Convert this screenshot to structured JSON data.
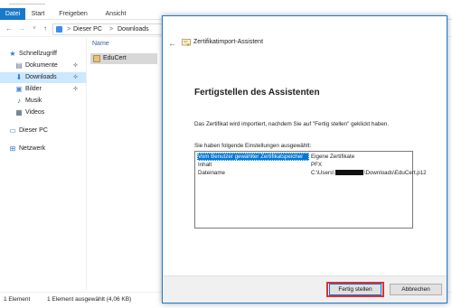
{
  "ribbon": {
    "tabs": [
      "Datei",
      "Start",
      "Freigeben",
      "Ansicht"
    ]
  },
  "addressbar": {
    "crumbs": [
      "Dieser PC",
      "Downloads"
    ],
    "separator": ">"
  },
  "sidebar": {
    "items": [
      {
        "label": "Schnellzugriff",
        "icon": "star-icon"
      },
      {
        "label": "Dokumente",
        "icon": "documents-icon",
        "pinned": true
      },
      {
        "label": "Downloads",
        "icon": "download-arrow-icon",
        "pinned": true,
        "selected": true
      },
      {
        "label": "Bilder",
        "icon": "pictures-icon",
        "pinned": true
      },
      {
        "label": "Musik",
        "icon": "music-note-icon"
      },
      {
        "label": "Videos",
        "icon": "video-icon"
      },
      {
        "label": "Dieser PC",
        "icon": "computer-icon"
      },
      {
        "label": "Netzwerk",
        "icon": "network-icon"
      }
    ]
  },
  "content": {
    "column_header": "Name",
    "files": [
      {
        "name": "EduCert",
        "icon": "certificate-file-icon"
      }
    ]
  },
  "statusbar": {
    "count": "1 Element",
    "selection": "1 Element ausgewählt (4,06 KB)"
  },
  "wizard": {
    "title": "Zertifikatimport-Assistent",
    "heading": "Fertigstellen des Assistenten",
    "description": "Das Zertifikat wird importiert, nachdem Sie auf \"Fertig stellen\" geklickt haben.",
    "settings_label": "Sie haben folgende Einstellungen ausgewählt:",
    "settings": [
      {
        "key": "Vom Benutzer gewählter Zertifikatspeicher",
        "value": "Eigene Zertifikate"
      },
      {
        "key": "Inhalt",
        "value": "PFX"
      },
      {
        "key": "Dateiname",
        "value_prefix": "C:\\Users\\",
        "value_suffix": "\\Downloads\\EduCert.p12"
      }
    ],
    "finish_button": "Fertig stellen",
    "cancel_button": "Abbrechen",
    "accent_color": "#0078d7",
    "highlight_color": "#e03030"
  }
}
